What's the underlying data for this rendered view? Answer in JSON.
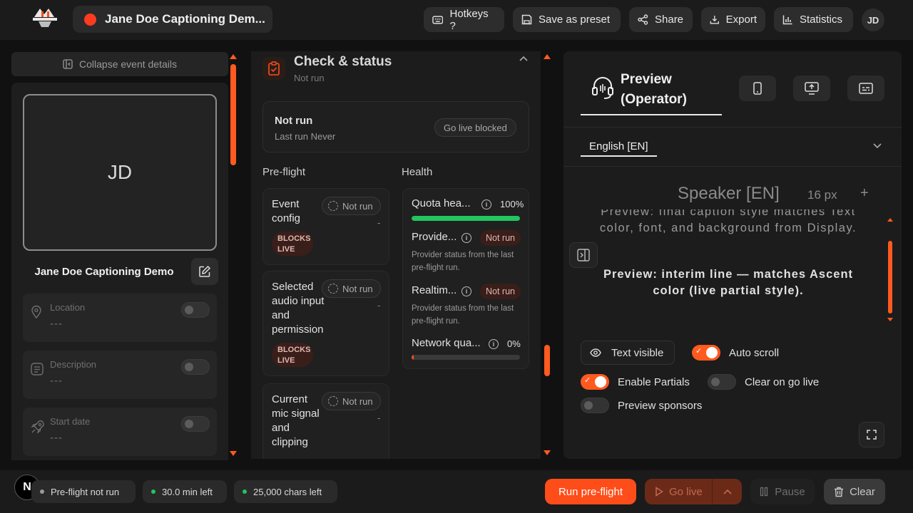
{
  "header": {
    "event_title": "Jane Doe Captioning Dem...",
    "buttons": {
      "hotkeys": "Hotkeys ?",
      "save_preset": "Save as preset",
      "share": "Share",
      "export": "Export",
      "statistics": "Statistics"
    },
    "user_initials": "JD"
  },
  "event_panel": {
    "collapse_label": "Collapse event details",
    "avatar_initials": "JD",
    "event_name": "Jane Doe Captioning Demo",
    "fields": [
      {
        "label": "Location",
        "value": "---",
        "icon": "location-pin-icon",
        "enabled": false
      },
      {
        "label": "Description",
        "value": "---",
        "icon": "document-icon",
        "enabled": false
      },
      {
        "label": "Start date",
        "value": "---",
        "icon": "rocket-icon",
        "enabled": false
      }
    ]
  },
  "check_status": {
    "title": "Check & status",
    "subtitle": "Not run",
    "status_card": {
      "title": "Not run",
      "last_run": "Last run Never",
      "go_live_state": "Go live blocked"
    },
    "preflight_label": "Pre-flight",
    "health_label": "Health",
    "preflight_items": [
      {
        "name": "Event config",
        "status": "Not run",
        "detail": "-",
        "blocks": "BLOCKS LIVE"
      },
      {
        "name": "Selected audio input and permission",
        "status": "Not run",
        "detail": "-",
        "blocks": "BLOCKS LIVE"
      },
      {
        "name": "Current mic signal and clipping",
        "status": "Not run",
        "detail": "-"
      }
    ],
    "health_items": [
      {
        "name": "Quota hea...",
        "value": "100%",
        "bar_fraction": 1.0,
        "bar_color": "#22c55e"
      },
      {
        "name": "Provide...",
        "status": "Not run",
        "desc": "Provider status from the last pre-flight run."
      },
      {
        "name": "Realtim...",
        "status": "Not run",
        "desc": "Provider status from the last pre-flight run."
      },
      {
        "name": "Network qua...",
        "value": "0%",
        "bar_fraction": 0.02,
        "bar_color": "#ff4d1a"
      }
    ]
  },
  "preview": {
    "tab_label": "Preview (Operator)",
    "language": "English [EN]",
    "speaker_label": "Speaker [EN]",
    "font_size": "16 px",
    "plus": "+",
    "final_line": "Preview: final caption style matches Text color, font, and background from Display.",
    "interim_line": "Preview: interim line — matches Ascent color (live partial style).",
    "controls": {
      "text_visible": "Text visible",
      "auto_scroll": "Auto scroll",
      "auto_scroll_on": true,
      "enable_partials": "Enable Partials",
      "enable_partials_on": true,
      "clear_on_go_live": "Clear on go live",
      "clear_on_go_live_on": false,
      "preview_sponsors": "Preview sponsors",
      "preview_sponsors_on": false
    }
  },
  "footer": {
    "badge": "N",
    "chips": [
      {
        "label": "Pre-flight not run",
        "dot_color": "#9a9a9a"
      },
      {
        "label": "30.0 min left",
        "dot_color": "#22c55e"
      },
      {
        "label": "25,000 chars left",
        "dot_color": "#22c55e"
      }
    ],
    "run_preflight": "Run pre-flight",
    "go_live": "Go live",
    "pause": "Pause",
    "clear": "Clear"
  },
  "colors": {
    "accent": "#ff5a1f",
    "background": "#111111",
    "panel": "#1c1c1c"
  }
}
